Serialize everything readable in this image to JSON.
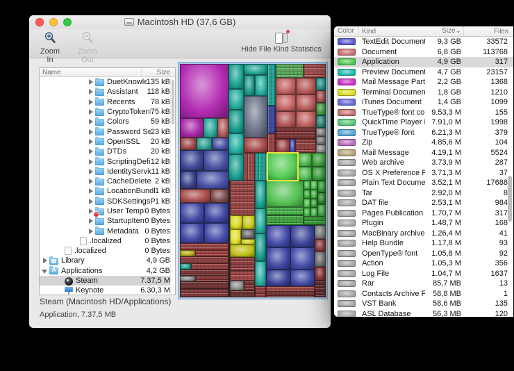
{
  "window": {
    "title": "Macintosh HD (37,6 GB)",
    "toolbar": {
      "zoom_in": "Zoom In",
      "zoom_out": "Zoom Out",
      "hide_stats": "Hide File Kind Statistics"
    },
    "status_line1": "Steam (Macintosh HD/Applications)",
    "status_line2": "Application, 7.37,5 MB"
  },
  "tree": {
    "columns": {
      "name": "Name",
      "size": "Size"
    },
    "items": [
      {
        "name": "DuetKnowledgeBa",
        "size": "135 kB",
        "indent": 3,
        "icon": "folder",
        "disclosure": "collapsed"
      },
      {
        "name": "Assistant",
        "size": "118 kB",
        "indent": 3,
        "icon": "folder",
        "disclosure": "collapsed"
      },
      {
        "name": "Recents",
        "size": "78 kB",
        "indent": 3,
        "icon": "folder",
        "disclosure": "collapsed"
      },
      {
        "name": "CryptoTokenKit",
        "size": "75 kB",
        "indent": 3,
        "icon": "folder",
        "disclosure": "collapsed"
      },
      {
        "name": "Colors",
        "size": "59 kB",
        "indent": 3,
        "icon": "folder",
        "disclosure": "collapsed"
      },
      {
        "name": "Password Server...",
        "size": "23 kB",
        "indent": 3,
        "icon": "folder",
        "disclosure": "collapsed"
      },
      {
        "name": "OpenSSL",
        "size": "20 kB",
        "indent": 3,
        "icon": "folder",
        "disclosure": "collapsed"
      },
      {
        "name": "DTDs",
        "size": "20 kB",
        "indent": 3,
        "icon": "folder",
        "disclosure": "collapsed"
      },
      {
        "name": "ScriptingDefinition",
        "size": "12 kB",
        "indent": 3,
        "icon": "folder",
        "disclosure": "collapsed"
      },
      {
        "name": "IdentityServices",
        "size": "11 kB",
        "indent": 3,
        "icon": "folder",
        "disclosure": "collapsed"
      },
      {
        "name": "CacheDelete",
        "size": "2 kB",
        "indent": 3,
        "icon": "folder",
        "disclosure": "collapsed"
      },
      {
        "name": "LocationBundles",
        "size": "1 kB",
        "indent": 3,
        "icon": "folder",
        "disclosure": "collapsed"
      },
      {
        "name": "SDKSettingsPlist",
        "size": "1 kB",
        "indent": 3,
        "icon": "folder",
        "disclosure": "collapsed"
      },
      {
        "name": "User Template",
        "size": "0 Bytes",
        "indent": 3,
        "icon": "folder-restricted",
        "disclosure": "collapsed"
      },
      {
        "name": "StartupItems",
        "size": "0 Bytes",
        "indent": 3,
        "icon": "folder",
        "disclosure": "collapsed"
      },
      {
        "name": "Metadata",
        "size": "0 Bytes",
        "indent": 3,
        "icon": "folder",
        "disclosure": "collapsed"
      },
      {
        "name": ".localized",
        "size": "0 Bytes",
        "indent": 2,
        "icon": "file",
        "disclosure": null
      },
      {
        "name": ".localized",
        "size": "0 Bytes",
        "indent": 1,
        "icon": "file",
        "disclosure": null
      },
      {
        "name": "Library",
        "size": "4,9 GB",
        "indent": 0,
        "icon": "folder-library",
        "disclosure": "collapsed"
      },
      {
        "name": "Applications",
        "size": "4,2 GB",
        "indent": 0,
        "icon": "folder-apps",
        "disclosure": "expanded"
      },
      {
        "name": "Steam",
        "size": "7.37,5 M",
        "indent": 1,
        "icon": "app-steam",
        "disclosure": null,
        "selected": true
      },
      {
        "name": "Keynote",
        "size": "6.30,3 M",
        "indent": 1,
        "icon": "app-keynote",
        "disclosure": null
      }
    ]
  },
  "stats": {
    "columns": {
      "color": "Color",
      "kind": "Kind",
      "size": "Size",
      "files": "Files"
    },
    "sort_indicator": "⌄",
    "rows": [
      {
        "kind": "TextEdit Document",
        "size": "9,3 GB",
        "files": "33572",
        "color": "#5a5ad2"
      },
      {
        "kind": "Document",
        "size": "6,8 GB",
        "files": "113768",
        "color": "#c87272"
      },
      {
        "kind": "Application",
        "size": "4,9 GB",
        "files": "317",
        "color": "#52c852",
        "selected": true
      },
      {
        "kind": "Preview Document",
        "size": "4,7 GB",
        "files": "23157",
        "color": "#22bcaa"
      },
      {
        "kind": "Mail Message Part",
        "size": "2,2 GB",
        "files": "1368",
        "color": "#c832c8"
      },
      {
        "kind": "Terminal Document",
        "size": "1,8 GB",
        "files": "1210",
        "color": "#dcdc28"
      },
      {
        "kind": "iTunes Document",
        "size": "1,4 GB",
        "files": "1099",
        "color": "#6a6ad8"
      },
      {
        "kind": "TrueType® font collect",
        "size": "9.53,3 M",
        "files": "155",
        "color": "#c87272"
      },
      {
        "kind": "QuickTime Player Doc",
        "size": "7.91,0 M",
        "files": "1998",
        "color": "#5ac878"
      },
      {
        "kind": "TrueType® font",
        "size": "6.21,3 M",
        "files": "379",
        "color": "#55a5d5"
      },
      {
        "kind": "Zip",
        "size": "4.85,6 M",
        "files": "104",
        "color": "#bc6ec0"
      },
      {
        "kind": "Mail Message",
        "size": "4.19,1 M",
        "files": "5524",
        "color": "#b4a478"
      },
      {
        "kind": "Web archive",
        "size": "3.73,9 M",
        "files": "287",
        "color": "#a8a8a8"
      },
      {
        "kind": "OS X Preference Pane",
        "size": "3.71,3 M",
        "files": "37",
        "color": "#a8a8a8"
      },
      {
        "kind": "Plain Text Document",
        "size": "3.52,1 M",
        "files": "17688",
        "color": "#a8a8a8"
      },
      {
        "kind": "Tar",
        "size": "2.92,0 M",
        "files": "8",
        "color": "#a8a8a8"
      },
      {
        "kind": "DAT file",
        "size": "2.53,1 M",
        "files": "984",
        "color": "#a8a8a8"
      },
      {
        "kind": "Pages Publication",
        "size": "1.70,7 M",
        "files": "317",
        "color": "#a8a8a8"
      },
      {
        "kind": "Plugin",
        "size": "1.48,7 M",
        "files": "168",
        "color": "#a8a8a8"
      },
      {
        "kind": "MacBinary archive",
        "size": "1.26,4 M",
        "files": "41",
        "color": "#a8a8a8"
      },
      {
        "kind": "Help Bundle",
        "size": "1.17,8 M",
        "files": "93",
        "color": "#a8a8a8"
      },
      {
        "kind": "OpenType® font",
        "size": "1.05,8 M",
        "files": "92",
        "color": "#a8a8a8"
      },
      {
        "kind": "Action",
        "size": "1.05,3 M",
        "files": "356",
        "color": "#a8a8a8"
      },
      {
        "kind": "Log File",
        "size": "1.04,7 M",
        "files": "1637",
        "color": "#a8a8a8"
      },
      {
        "kind": "Rar",
        "size": "85,7 MB",
        "files": "13",
        "color": "#a8a8a8"
      },
      {
        "kind": "Contacts Archive File",
        "size": "58,8 MB",
        "files": "1",
        "color": "#a8a8a8"
      },
      {
        "kind": "VST Bank",
        "size": "58,6 MB",
        "files": "135",
        "color": "#a8a8a8"
      },
      {
        "kind": "ASL Database",
        "size": "56,3 MB",
        "files": "120",
        "color": "#a8a8a8"
      }
    ]
  },
  "treemap": {
    "selected_outline": "#f2e438",
    "cells": [
      [
        0,
        0,
        70,
        78,
        "#b32cb3",
        "cu"
      ],
      [
        0,
        78,
        34,
        28,
        "#a626a6",
        "cu"
      ],
      [
        34,
        78,
        20,
        28,
        "#2aa89a",
        "cu"
      ],
      [
        54,
        78,
        16,
        28,
        "#b05c5c",
        "cu"
      ],
      [
        0,
        106,
        24,
        18,
        "#9c4848",
        "cu"
      ],
      [
        24,
        106,
        22,
        18,
        "#30a092",
        "cu"
      ],
      [
        46,
        106,
        24,
        18,
        "#4c54a4",
        "cu"
      ],
      [
        0,
        124,
        34,
        30,
        "#3e4694",
        "cu"
      ],
      [
        34,
        124,
        36,
        30,
        "#4750a2",
        "cu"
      ],
      [
        0,
        154,
        24,
        26,
        "#3a4288",
        "cu"
      ],
      [
        24,
        154,
        46,
        26,
        "#4952a6",
        "cu"
      ],
      [
        0,
        180,
        44,
        20,
        "#a84c4c",
        "cu"
      ],
      [
        44,
        180,
        26,
        20,
        "#7e4c4c",
        "cu"
      ],
      [
        0,
        200,
        35,
        29,
        "#424aa6",
        "cu"
      ],
      [
        35,
        200,
        35,
        29,
        "#3d45a0",
        "cu"
      ],
      [
        0,
        229,
        35,
        29,
        "#3f47a2",
        "cu"
      ],
      [
        35,
        229,
        35,
        29,
        "#444ca8",
        "cu"
      ],
      [
        0,
        258,
        70,
        10,
        "#9a4242",
        "th"
      ],
      [
        0,
        268,
        22,
        9,
        "#b4ac1c",
        "cu"
      ],
      [
        22,
        268,
        48,
        9,
        "#9c4040",
        "th"
      ],
      [
        0,
        277,
        70,
        10,
        "#8e3c3c",
        "th"
      ],
      [
        0,
        287,
        16,
        9,
        "#22a090",
        "cu"
      ],
      [
        16,
        287,
        54,
        9,
        "#963e3e",
        "th"
      ],
      [
        0,
        296,
        70,
        9,
        "#7c3838",
        "th"
      ],
      [
        0,
        305,
        22,
        8,
        "#8a8a8a",
        "cu"
      ],
      [
        22,
        305,
        48,
        8,
        "#8e3a3a",
        "th"
      ],
      [
        0,
        313,
        70,
        11,
        "#6e3232",
        "th"
      ],
      [
        0,
        324,
        70,
        12,
        "#803a3a",
        "th"
      ],
      [
        70,
        0,
        22,
        36,
        "#1ba193",
        "cu"
      ],
      [
        70,
        36,
        22,
        30,
        "#23ab9d",
        "cu"
      ],
      [
        70,
        66,
        22,
        34,
        "#189a8c",
        "cu"
      ],
      [
        70,
        100,
        22,
        30,
        "#27b0a2",
        "cu"
      ],
      [
        70,
        130,
        22,
        38,
        "#1b9f91",
        "cu"
      ],
      [
        92,
        0,
        34,
        16,
        "#20a294",
        "cu"
      ],
      [
        92,
        16,
        16,
        30,
        "#1d9688",
        "cu"
      ],
      [
        108,
        16,
        18,
        30,
        "#28b0a0",
        "cu"
      ],
      [
        92,
        46,
        34,
        60,
        "#6a7288",
        "cu"
      ],
      [
        92,
        106,
        34,
        22,
        "#a84a4a",
        "cu"
      ],
      [
        92,
        128,
        16,
        40,
        "#9c4646",
        "tv"
      ],
      [
        108,
        128,
        18,
        40,
        "#1ea296",
        "tv"
      ],
      [
        126,
        0,
        12,
        60,
        "#23a597",
        "tv"
      ],
      [
        126,
        60,
        12,
        40,
        "#4049a0",
        "tv"
      ],
      [
        126,
        100,
        12,
        28,
        "#9a4444",
        "tv"
      ],
      [
        138,
        0,
        40,
        20,
        "#5aa85a",
        "th"
      ],
      [
        178,
        0,
        32,
        20,
        "#a85050",
        "th"
      ],
      [
        138,
        20,
        29,
        24,
        "#c06060",
        "cu"
      ],
      [
        167,
        20,
        29,
        24,
        "#b85858",
        "cu"
      ],
      [
        138,
        44,
        29,
        24,
        "#c46464",
        "cu"
      ],
      [
        167,
        44,
        29,
        24,
        "#bc5c5c",
        "cu"
      ],
      [
        138,
        68,
        29,
        24,
        "#b05454",
        "cu"
      ],
      [
        167,
        68,
        29,
        24,
        "#c06060",
        "cu"
      ],
      [
        196,
        20,
        14,
        18,
        "#28a89a",
        "cu"
      ],
      [
        196,
        38,
        14,
        18,
        "#b05858",
        "cu"
      ],
      [
        196,
        56,
        14,
        18,
        "#48a848",
        "cu"
      ],
      [
        196,
        74,
        14,
        18,
        "#308f82",
        "cu"
      ],
      [
        138,
        92,
        58,
        16,
        "#7e3434",
        "th"
      ],
      [
        196,
        92,
        14,
        12,
        "#989898",
        "cu"
      ],
      [
        196,
        104,
        14,
        12,
        "#8a8a8a",
        "cu"
      ],
      [
        196,
        116,
        14,
        12,
        "#a0a0a0",
        "cu"
      ],
      [
        138,
        108,
        20,
        20,
        "#a04848",
        "cu"
      ],
      [
        158,
        108,
        8,
        20,
        "#4850b0",
        "cu"
      ],
      [
        166,
        108,
        30,
        20,
        "#964242",
        "th"
      ],
      [
        126,
        128,
        44,
        40,
        "#55cc55",
        "cu",
        1
      ],
      [
        170,
        128,
        20,
        20,
        "#4cb84c",
        "cu"
      ],
      [
        190,
        128,
        20,
        20,
        "#44b044",
        "cu"
      ],
      [
        170,
        148,
        20,
        20,
        "#52c052",
        "cu"
      ],
      [
        190,
        148,
        20,
        20,
        "#3ea83e",
        "cu"
      ],
      [
        72,
        168,
        36,
        50,
        "#9a4444",
        "th"
      ],
      [
        72,
        218,
        18,
        20,
        "#d8d820",
        "cu"
      ],
      [
        90,
        218,
        18,
        20,
        "#c8c818",
        "cu"
      ],
      [
        72,
        238,
        16,
        22,
        "#e0e028",
        "cu"
      ],
      [
        88,
        238,
        20,
        14,
        "#6a6a6a",
        "cu"
      ],
      [
        88,
        252,
        20,
        8,
        "#d0d020",
        "cu"
      ],
      [
        72,
        260,
        36,
        18,
        "#c0c018",
        "cu"
      ],
      [
        72,
        278,
        36,
        20,
        "#8e3e3e",
        "th"
      ],
      [
        72,
        298,
        36,
        14,
        "#a04646",
        "th"
      ],
      [
        72,
        312,
        20,
        14,
        "#909090",
        "cu"
      ],
      [
        92,
        312,
        16,
        14,
        "#7a3636",
        "th"
      ],
      [
        72,
        326,
        36,
        10,
        "#6e3030",
        "th"
      ],
      [
        108,
        168,
        16,
        40,
        "#1da295",
        "cu"
      ],
      [
        108,
        208,
        16,
        36,
        "#25ada0",
        "cu"
      ],
      [
        108,
        244,
        16,
        40,
        "#1b9d8f",
        "cu"
      ],
      [
        108,
        284,
        16,
        36,
        "#28b2a4",
        "cu"
      ],
      [
        108,
        320,
        16,
        16,
        "#8e3c3c",
        "th"
      ],
      [
        124,
        168,
        54,
        38,
        "#52c052",
        "cu"
      ],
      [
        178,
        168,
        10,
        13,
        "#48b848",
        "cu"
      ],
      [
        188,
        168,
        10,
        13,
        "#56c856",
        "cu"
      ],
      [
        178,
        181,
        10,
        13,
        "#3fae3f",
        "cu"
      ],
      [
        188,
        181,
        10,
        13,
        "#4cbc4c",
        "cu"
      ],
      [
        178,
        194,
        10,
        13,
        "#52c452",
        "cu"
      ],
      [
        188,
        194,
        10,
        13,
        "#3aa83a",
        "cu"
      ],
      [
        178,
        207,
        10,
        13,
        "#46b446",
        "cu"
      ],
      [
        188,
        207,
        10,
        13,
        "#50c050",
        "cu"
      ],
      [
        198,
        168,
        12,
        17,
        "#3aa83a",
        "cu"
      ],
      [
        198,
        185,
        12,
        17,
        "#2f9830",
        "cu"
      ],
      [
        198,
        202,
        12,
        18,
        "#46b046",
        "cu"
      ],
      [
        124,
        206,
        54,
        12,
        "#49b049",
        "th"
      ],
      [
        124,
        218,
        54,
        14,
        "#3fa83f",
        "th"
      ],
      [
        178,
        220,
        32,
        12,
        "#38a038",
        "th"
      ],
      [
        124,
        232,
        35,
        32,
        "#4049a6",
        "cu"
      ],
      [
        159,
        232,
        35,
        32,
        "#3a4398",
        "cu"
      ],
      [
        124,
        264,
        35,
        32,
        "#3e47a0",
        "cu"
      ],
      [
        159,
        264,
        35,
        32,
        "#444da8",
        "cu"
      ],
      [
        124,
        296,
        35,
        24,
        "#3a4296",
        "cu"
      ],
      [
        159,
        296,
        35,
        24,
        "#434ba8",
        "cu"
      ],
      [
        194,
        232,
        16,
        20,
        "#8a8a8a",
        "cu"
      ],
      [
        194,
        252,
        16,
        18,
        "#964242",
        "cu"
      ],
      [
        194,
        270,
        16,
        22,
        "#7e7e7e",
        "cu"
      ],
      [
        194,
        292,
        16,
        20,
        "#8e3c3c",
        "cu"
      ],
      [
        194,
        312,
        16,
        24,
        "#6e3232",
        "th"
      ],
      [
        124,
        320,
        70,
        8,
        "#9a4444",
        "th"
      ],
      [
        124,
        328,
        70,
        8,
        "#7a3434",
        "th"
      ]
    ]
  },
  "colors": {
    "row_selection": "#d4d4d4",
    "treemap_focus_ring": "#a6c8e8",
    "traffic_close": "#fc5b57",
    "traffic_min": "#fdbe41",
    "traffic_zoom": "#34c84a"
  }
}
